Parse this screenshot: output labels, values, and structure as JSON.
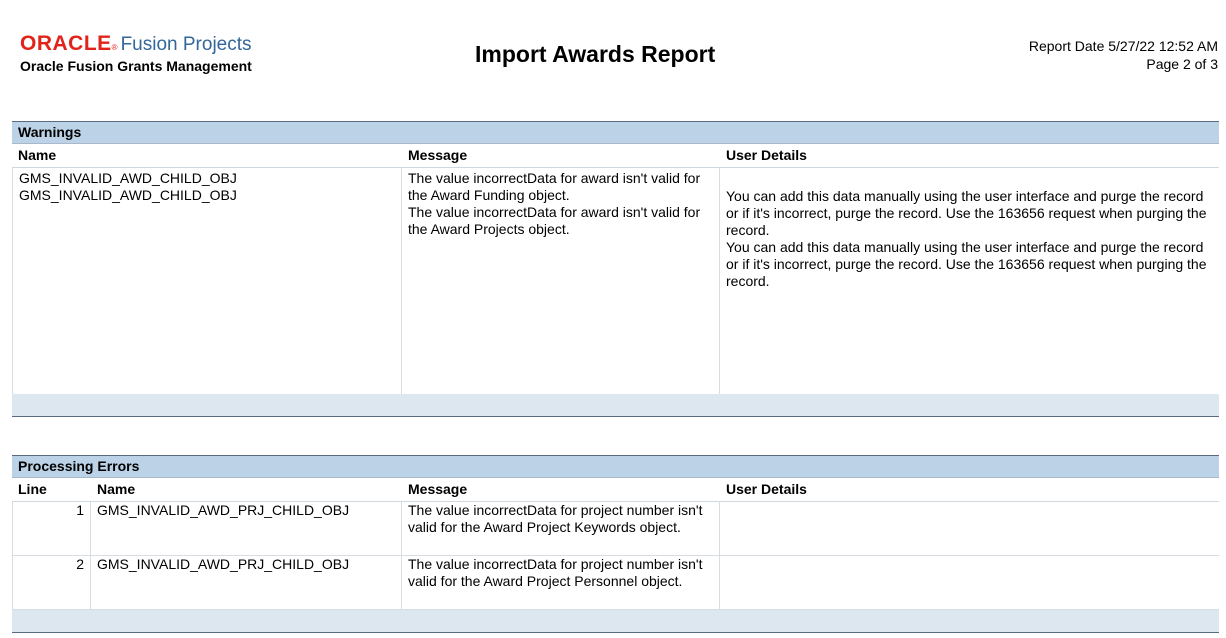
{
  "header": {
    "brand": "ORACLE",
    "product": "Fusion Projects",
    "subtitle": "Oracle Fusion Grants Management",
    "title": "Import Awards Report",
    "report_date": "Report Date 5/27/22 12:52 AM",
    "page": "Page 2 of 3"
  },
  "warnings": {
    "heading": "Warnings",
    "columns": [
      "Name",
      "Message",
      "User Details"
    ],
    "row": {
      "names": [
        "GMS_INVALID_AWD_CHILD_OBJ",
        "GMS_INVALID_AWD_CHILD_OBJ"
      ],
      "messages": [
        "The value incorrectData for award isn't valid for the Award Funding object.",
        "The value incorrectData for award isn't valid for the Award Projects object."
      ],
      "details": [
        "You can add this data manually using the user interface and purge the record or if it's incorrect, purge the record. Use the 163656 request when purging the record.",
        "You can add this data manually using the user interface and purge the record or if it's incorrect, purge the record. Use the 163656 request when purging the record."
      ]
    }
  },
  "errors": {
    "heading": "Processing Errors",
    "columns": [
      "Line",
      "Name",
      "Message",
      "User Details"
    ],
    "rows": [
      {
        "line": "1",
        "name": "GMS_INVALID_AWD_PRJ_CHILD_OBJ",
        "message": "The value incorrectData for project number isn't valid for the Award Project Keywords object.",
        "details": ""
      },
      {
        "line": "2",
        "name": "GMS_INVALID_AWD_PRJ_CHILD_OBJ",
        "message": "The value incorrectData for project number isn't valid for the Award Project Personnel object.",
        "details": ""
      }
    ]
  }
}
